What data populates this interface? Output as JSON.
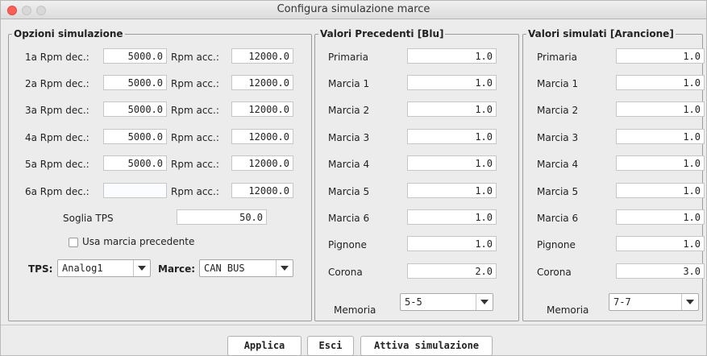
{
  "window": {
    "title": "Configura simulazione marce"
  },
  "options": {
    "legend": "Opzioni simulazione",
    "rows": [
      {
        "dec_label": "1a Rpm dec.:",
        "dec_value": "5000.0",
        "acc_label": "Rpm acc.:",
        "acc_value": "12000.0"
      },
      {
        "dec_label": "2a Rpm dec.:",
        "dec_value": "5000.0",
        "acc_label": "Rpm acc.:",
        "acc_value": "12000.0"
      },
      {
        "dec_label": "3a Rpm dec.:",
        "dec_value": "5000.0",
        "acc_label": "Rpm acc.:",
        "acc_value": "12000.0"
      },
      {
        "dec_label": "4a Rpm dec.:",
        "dec_value": "5000.0",
        "acc_label": "Rpm acc.:",
        "acc_value": "12000.0"
      },
      {
        "dec_label": "5a Rpm dec.:",
        "dec_value": "5000.0",
        "acc_label": "Rpm acc.:",
        "acc_value": "12000.0"
      },
      {
        "dec_label": "6a Rpm dec.:",
        "dec_value": "",
        "acc_label": "Rpm acc.:",
        "acc_value": "12000.0"
      }
    ],
    "tps_threshold_label": "Soglia TPS",
    "tps_threshold_value": "50.0",
    "use_previous_gear_label": "Usa marcia precedente",
    "tps_label": "TPS:",
    "tps_selected": "Analog1",
    "gears_label": "Marce:",
    "gears_selected": "CAN BUS"
  },
  "previous": {
    "legend": "Valori Precedenti [Blu]",
    "rows": [
      {
        "label": "Primaria",
        "value": "1.0"
      },
      {
        "label": "Marcia 1",
        "value": "1.0"
      },
      {
        "label": "Marcia 2",
        "value": "1.0"
      },
      {
        "label": "Marcia 3",
        "value": "1.0"
      },
      {
        "label": "Marcia 4",
        "value": "1.0"
      },
      {
        "label": "Marcia 5",
        "value": "1.0"
      },
      {
        "label": "Marcia 6",
        "value": "1.0"
      },
      {
        "label": "Pignone",
        "value": "1.0"
      },
      {
        "label": "Corona",
        "value": "2.0"
      }
    ],
    "memory_label": "Memoria",
    "memory_selected": "5-5"
  },
  "simulated": {
    "legend": "Valori simulati [Arancione]",
    "rows": [
      {
        "label": "Primaria",
        "value": "1.0"
      },
      {
        "label": "Marcia 1",
        "value": "1.0"
      },
      {
        "label": "Marcia 2",
        "value": "1.0"
      },
      {
        "label": "Marcia 3",
        "value": "1.0"
      },
      {
        "label": "Marcia 4",
        "value": "1.0"
      },
      {
        "label": "Marcia 5",
        "value": "1.0"
      },
      {
        "label": "Marcia 6",
        "value": "1.0"
      },
      {
        "label": "Pignone",
        "value": "1.0"
      },
      {
        "label": "Corona",
        "value": "3.0"
      }
    ],
    "memory_label": "Memoria",
    "memory_selected": "7-7"
  },
  "buttons": {
    "apply": "Applica",
    "exit": "Esci",
    "start_sim": "Attiva simulazione"
  }
}
